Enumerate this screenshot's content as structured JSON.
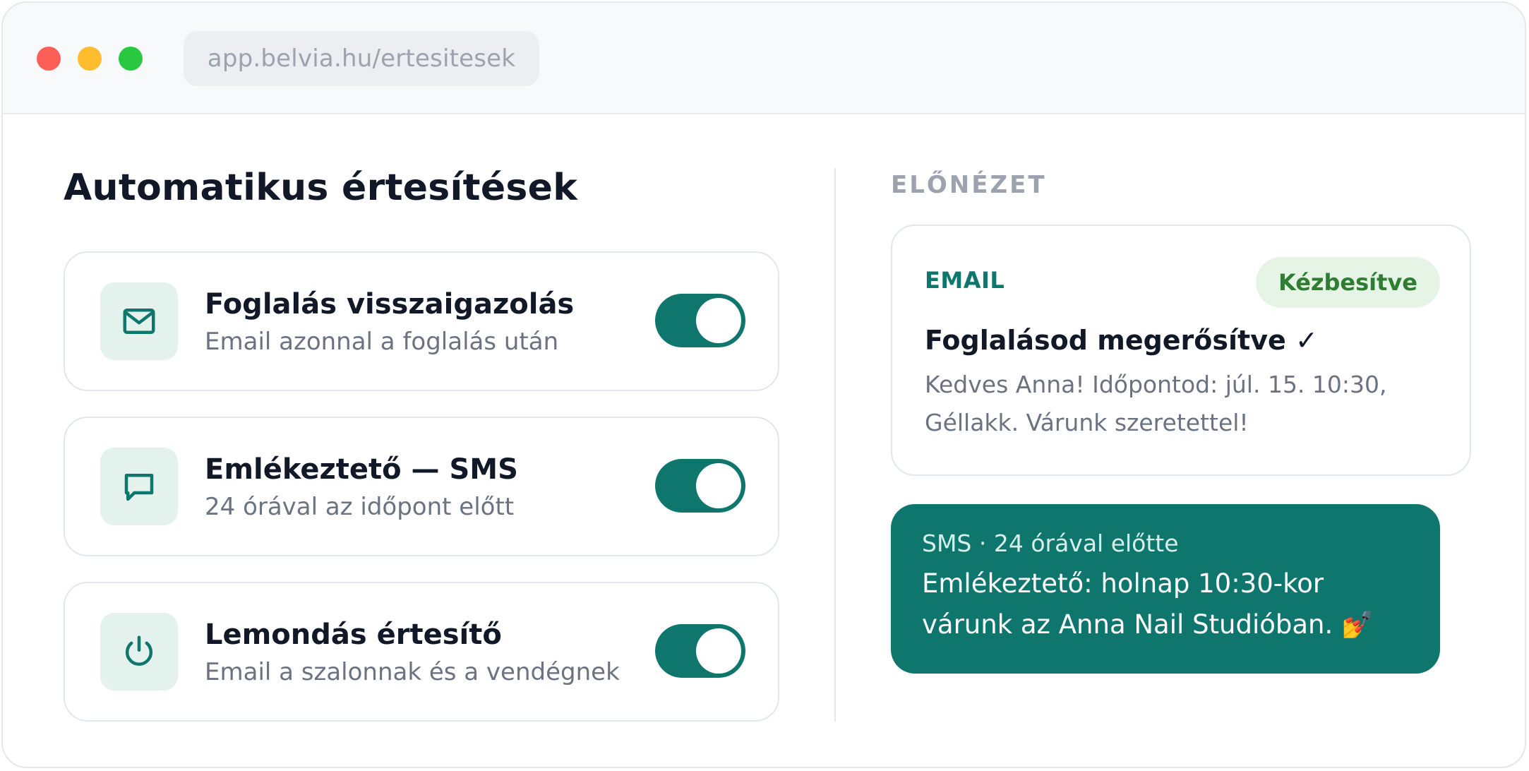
{
  "browser": {
    "url": "app.belvia.hu/ertesitesek"
  },
  "main": {
    "title": "Automatikus értesítések",
    "notifications": [
      {
        "icon": "mail-icon",
        "title": "Foglalás visszaigazolás",
        "subtitle": "Email azonnal a foglalás után",
        "enabled": true
      },
      {
        "icon": "message-bubble-icon",
        "title": "Emlékeztető — SMS",
        "subtitle": "24 órával az időpont előtt",
        "enabled": true
      },
      {
        "icon": "power-icon",
        "title": "Lemondás értesítő",
        "subtitle": "Email a szalonnak és a vendégnek",
        "enabled": true
      }
    ]
  },
  "preview": {
    "heading": "ELŐNÉZET",
    "email": {
      "channel": "EMAIL",
      "status": "Kézbesítve",
      "subject": "Foglalásod megerősítve ✓",
      "body": "Kedves Anna! Időpontod: júl. 15. 10:30, Géllakk. Várunk szeretettel!"
    },
    "sms": {
      "meta": "SMS · 24 órával előtte",
      "body": "Emlékeztető: holnap 10:30-kor várunk az Anna Nail Studióban. 💅"
    }
  },
  "colors": {
    "accent": "#0f766e",
    "icon_bg": "#e3f2ec",
    "badge_bg": "#e6f4e6",
    "badge_text": "#2e7d32"
  }
}
